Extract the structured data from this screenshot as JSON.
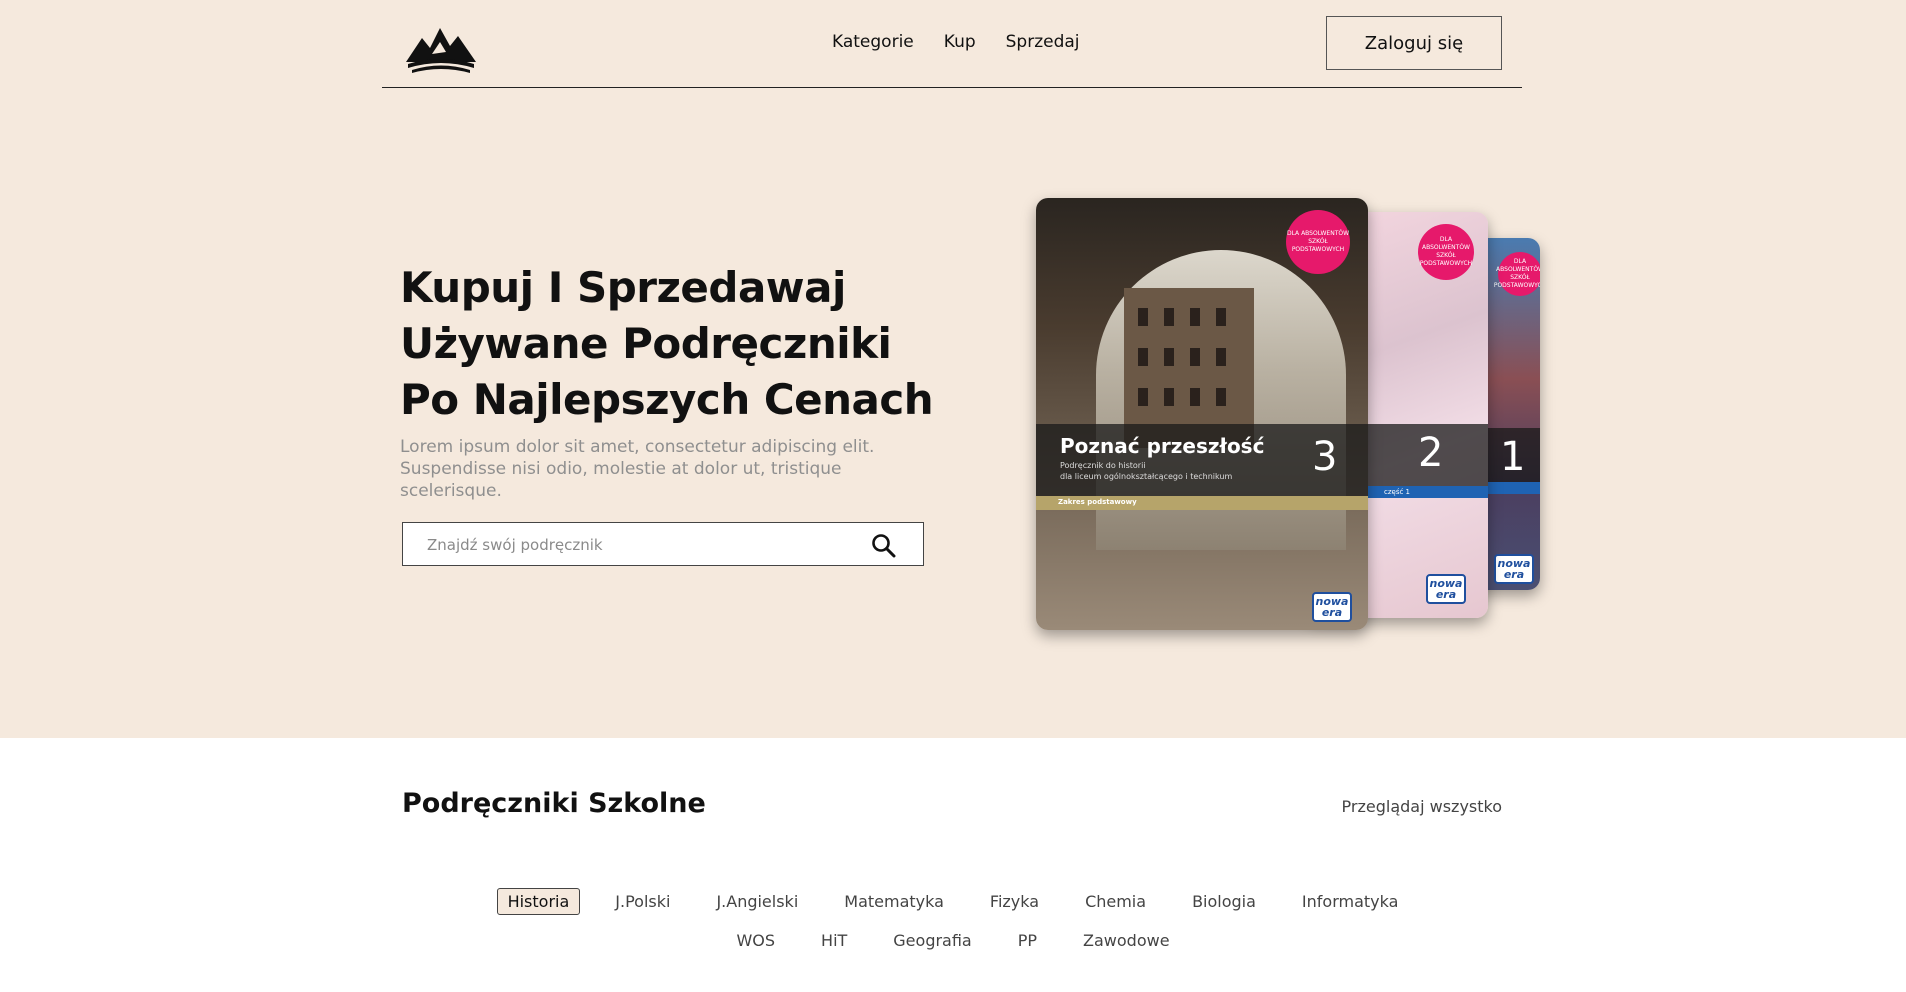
{
  "header": {
    "logo": "mountain-book-logo",
    "nav": [
      "Kategorie",
      "Kup",
      "Sprzedaj"
    ],
    "login_label": "Zaloguj się"
  },
  "hero": {
    "title": "Kupuj I Sprzedawaj\nUżywane Podręczniki\nPo Najlepszych Cenach",
    "subtitle": "Lorem ipsum dolor sit amet, consectetur adipiscing elit.\nSuspendisse nisi odio, molestie at dolor ut, tristique scelerisque.",
    "search_placeholder": "Znajdź swój podręcznik",
    "books": [
      {
        "seal": "DLA ABSOLWENTÓW SZKÓŁ PODSTAWOWYCH",
        "title": "Poznać przeszłość",
        "subtitle": "Podręcznik do historii\ndla liceum ogólnokształcącego i technikum",
        "number": "3",
        "band": "Zakres podstawowy",
        "publisher": "nowa era"
      },
      {
        "seal": "DLA ABSOLWENTÓW SZKÓŁ PODSTAWOWYCH",
        "number": "2",
        "band": "część 1",
        "publisher": "nowa era"
      },
      {
        "seal": "DLA ABSOLWENTÓW SZKÓŁ PODSTAWOWYCH",
        "number": "1",
        "publisher": "nowa era"
      }
    ]
  },
  "section": {
    "title": "Podręczniki Szkolne",
    "view_all": "Przeglądaj wszystko",
    "categories_row1": [
      "Historia",
      "J.Polski",
      "J.Angielski",
      "Matematyka",
      "Fizyka",
      "Chemia",
      "Biologia",
      "Informatyka"
    ],
    "categories_row2": [
      "WOS",
      "HiT",
      "Geografia",
      "PP",
      "Zawodowe"
    ],
    "active_category": "Historia"
  },
  "colors": {
    "hero_bg": "#f5e9dd",
    "seal_pink": "#e6196b",
    "publisher_blue": "#1f4f9e"
  },
  "icons": {
    "search": "search-icon"
  }
}
